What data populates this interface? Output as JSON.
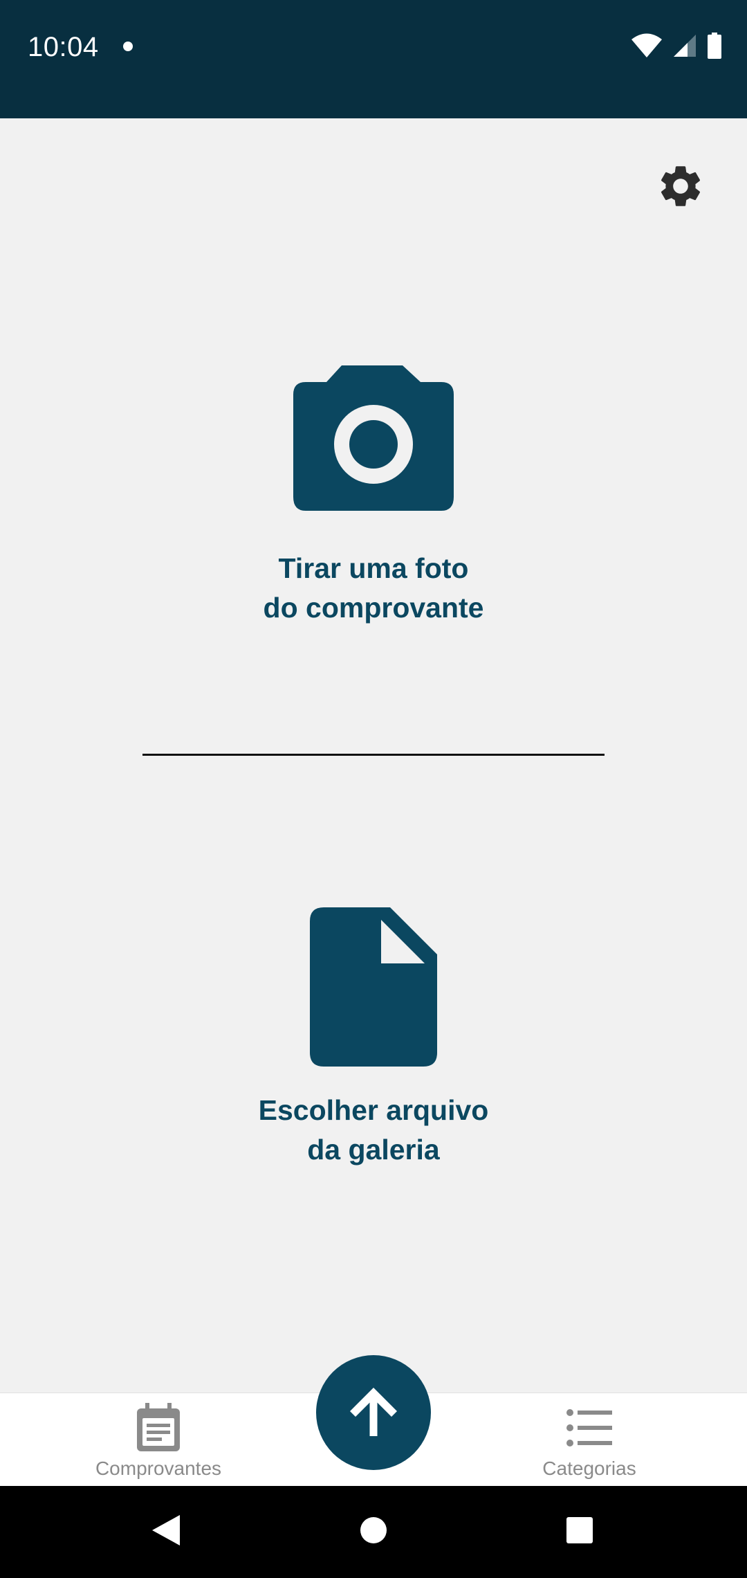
{
  "status_bar": {
    "time": "10:04",
    "icons": [
      "notification-dot-icon",
      "wifi-icon",
      "signal-icon",
      "battery-icon"
    ],
    "background": "#082f40"
  },
  "header": {
    "settings_icon": "gear-icon"
  },
  "actions": {
    "camera": {
      "icon": "camera-icon",
      "label_line1": "Tirar uma foto",
      "label_line2": "do comprovante"
    },
    "gallery": {
      "icon": "file-icon",
      "label_line1": "Escolher arquivo",
      "label_line2": "da galeria"
    }
  },
  "bottom_nav": {
    "items": [
      {
        "label": "Comprovantes",
        "icon": "calendar-receipt-icon"
      },
      {
        "label": "Categorias",
        "icon": "list-icon"
      }
    ],
    "fab_icon": "arrow-up-icon"
  },
  "system_nav": {
    "buttons": [
      "back-icon",
      "home-icon",
      "recents-icon"
    ]
  },
  "colors": {
    "accent": "#0b4760",
    "background": "#f1f1f1",
    "nav_label": "#8a8a8a"
  }
}
